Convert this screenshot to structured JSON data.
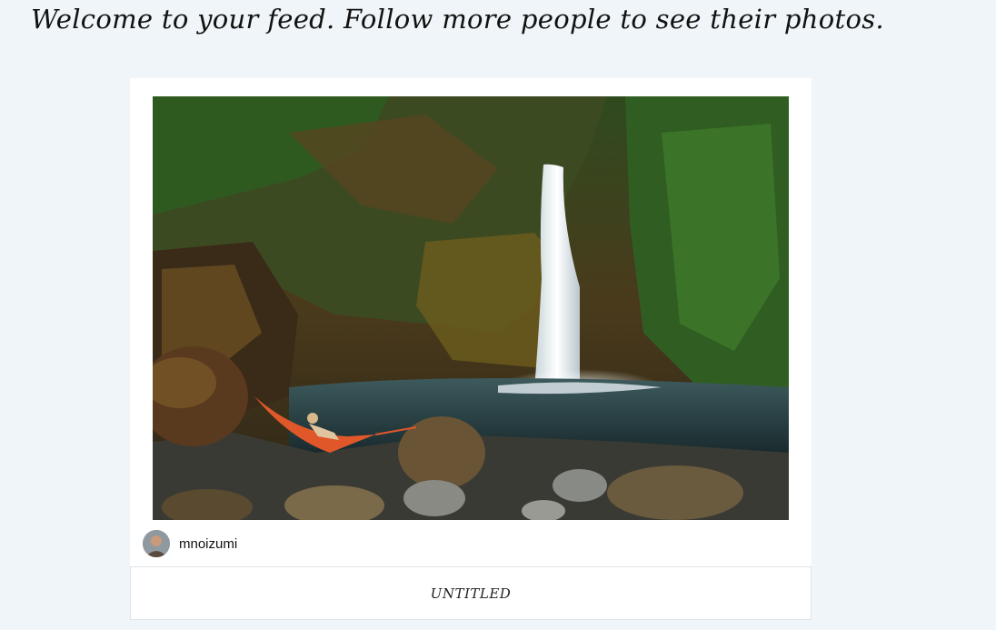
{
  "feed": {
    "welcome_message": "Welcome to your feed. Follow more people to see their photos."
  },
  "post": {
    "photo_icon": "waterfall-photo",
    "author": {
      "username": "mnoizumi",
      "avatar_icon": "user-avatar"
    },
    "caption": "UNTITLED"
  },
  "colors": {
    "page_background": "#eff5f8",
    "card_background": "#ffffff"
  }
}
